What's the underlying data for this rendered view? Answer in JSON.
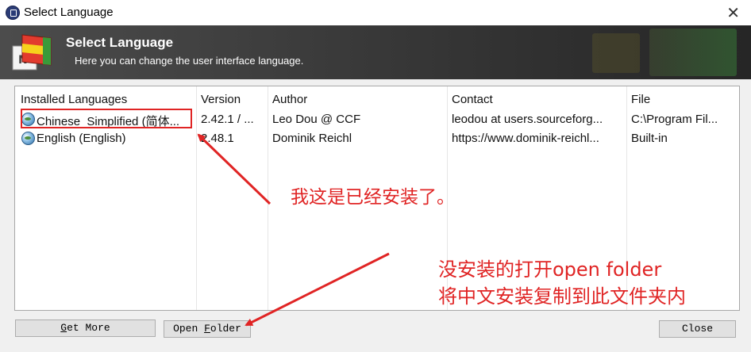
{
  "window": {
    "title": "Select Language",
    "close_glyph": "✕"
  },
  "banner": {
    "heading": "Select Language",
    "subheading": "Here you can change the user interface language."
  },
  "table": {
    "columns": [
      "Installed Languages",
      "Version",
      "Author",
      "Contact",
      "File"
    ],
    "rows": [
      {
        "language": "Chinese_Simplified (简体...",
        "version": "2.42.1 / ...",
        "author": "Leo Dou @ CCF",
        "contact": "leodou at users.sourceforg...",
        "file": "C:\\Program Fil...",
        "icon": "globe-icon"
      },
      {
        "language": "English (English)",
        "version": "2.48.1",
        "author": "Dominik Reichl",
        "contact": "https://www.dominik-reichl...",
        "file": "Built-in",
        "icon": "globe-icon"
      }
    ]
  },
  "buttons": {
    "get_more_prefix": "",
    "get_more_hotkey": "G",
    "get_more_rest": "et More",
    "open_folder_prefix": "Open ",
    "open_folder_hotkey": "F",
    "open_folder_rest": "older",
    "close": "Close"
  },
  "annotations": {
    "note1": "我这是已经安装了。",
    "note2_line1": "没安装的打开open folder",
    "note2_line2": "将中文安装复制到此文件夹内"
  },
  "colors": {
    "annotation_red": "#e02424",
    "banner_dark": "#262626"
  }
}
